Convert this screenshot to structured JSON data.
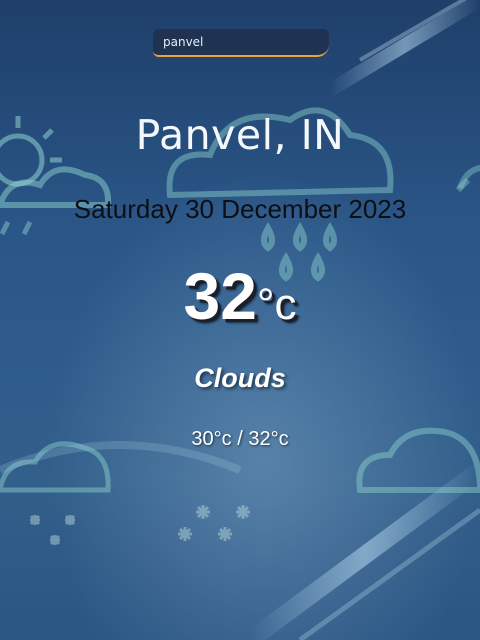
{
  "search": {
    "value": "panvel",
    "placeholder": ""
  },
  "location": {
    "display": "Panvel, IN"
  },
  "date": {
    "display": "Saturday 30 December 2023"
  },
  "current": {
    "temp": "32",
    "unit": "°c"
  },
  "weather": {
    "condition": "Clouds",
    "range": "30°c / 32°c"
  },
  "icons": {
    "background": [
      "sun-icon",
      "cloud-icon",
      "rain-cloud-icon",
      "snow-cloud-icon",
      "snowflake-icon"
    ]
  }
}
